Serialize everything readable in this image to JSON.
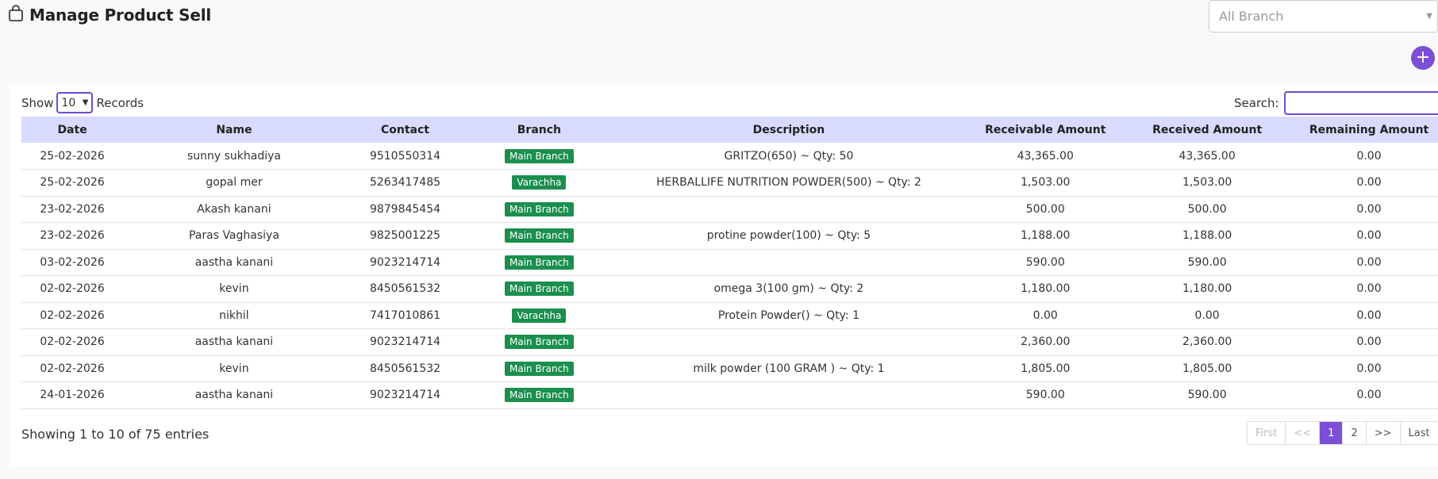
{
  "header": {
    "title": "Manage Product Sell",
    "branch_filter": "All Branch",
    "add_label": "+"
  },
  "toolbar": {
    "show_label": "Show",
    "length_value": "10",
    "records_label": "Records",
    "search_label": "Search:"
  },
  "table": {
    "columns": [
      "Date",
      "Name",
      "Contact",
      "Branch",
      "Description",
      "Receivable Amount",
      "Received Amount",
      "Remaining Amount"
    ],
    "rows": [
      {
        "date": "25-02-2026",
        "name": "sunny sukhadiya",
        "contact": "9510550314",
        "branch": "Main Branch",
        "description": "GRITZO(650) ~ Qty: 50",
        "receivable": "43,365.00",
        "received": "43,365.00",
        "remaining": "0.00"
      },
      {
        "date": "25-02-2026",
        "name": "gopal mer",
        "contact": "5263417485",
        "branch": "Varachha",
        "description": "HERBALLIFE NUTRITION POWDER(500) ~ Qty: 2",
        "receivable": "1,503.00",
        "received": "1,503.00",
        "remaining": "0.00"
      },
      {
        "date": "23-02-2026",
        "name": "Akash kanani",
        "contact": "9879845454",
        "branch": "Main Branch",
        "description": "",
        "receivable": "500.00",
        "received": "500.00",
        "remaining": "0.00"
      },
      {
        "date": "23-02-2026",
        "name": "Paras Vaghasiya",
        "contact": "9825001225",
        "branch": "Main Branch",
        "description": "protine powder(100) ~ Qty: 5",
        "receivable": "1,188.00",
        "received": "1,188.00",
        "remaining": "0.00"
      },
      {
        "date": "03-02-2026",
        "name": "aastha kanani",
        "contact": "9023214714",
        "branch": "Main Branch",
        "description": "",
        "receivable": "590.00",
        "received": "590.00",
        "remaining": "0.00"
      },
      {
        "date": "02-02-2026",
        "name": "kevin",
        "contact": "8450561532",
        "branch": "Main Branch",
        "description": "omega 3(100 gm) ~ Qty: 2",
        "receivable": "1,180.00",
        "received": "1,180.00",
        "remaining": "0.00"
      },
      {
        "date": "02-02-2026",
        "name": "nikhil",
        "contact": "7417010861",
        "branch": "Varachha",
        "description": "Protein Powder() ~ Qty: 1",
        "receivable": "0.00",
        "received": "0.00",
        "remaining": "0.00"
      },
      {
        "date": "02-02-2026",
        "name": "aastha kanani",
        "contact": "9023214714",
        "branch": "Main Branch",
        "description": "",
        "receivable": "2,360.00",
        "received": "2,360.00",
        "remaining": "0.00"
      },
      {
        "date": "02-02-2026",
        "name": "kevin",
        "contact": "8450561532",
        "branch": "Main Branch",
        "description": "milk powder (100 GRAM ) ~ Qty: 1",
        "receivable": "1,805.00",
        "received": "1,805.00",
        "remaining": "0.00"
      },
      {
        "date": "24-01-2026",
        "name": "aastha kanani",
        "contact": "9023214714",
        "branch": "Main Branch",
        "description": "",
        "receivable": "590.00",
        "received": "590.00",
        "remaining": "0.00"
      }
    ]
  },
  "footer": {
    "info": "Showing 1 to 10 of 75 entries",
    "pager": [
      "First",
      "<<",
      "1",
      "2",
      ">>",
      "Last"
    ]
  },
  "colors": {
    "accent": "#7b4fd6",
    "header_row": "#d9daff",
    "badge": "#1a8f4e"
  }
}
